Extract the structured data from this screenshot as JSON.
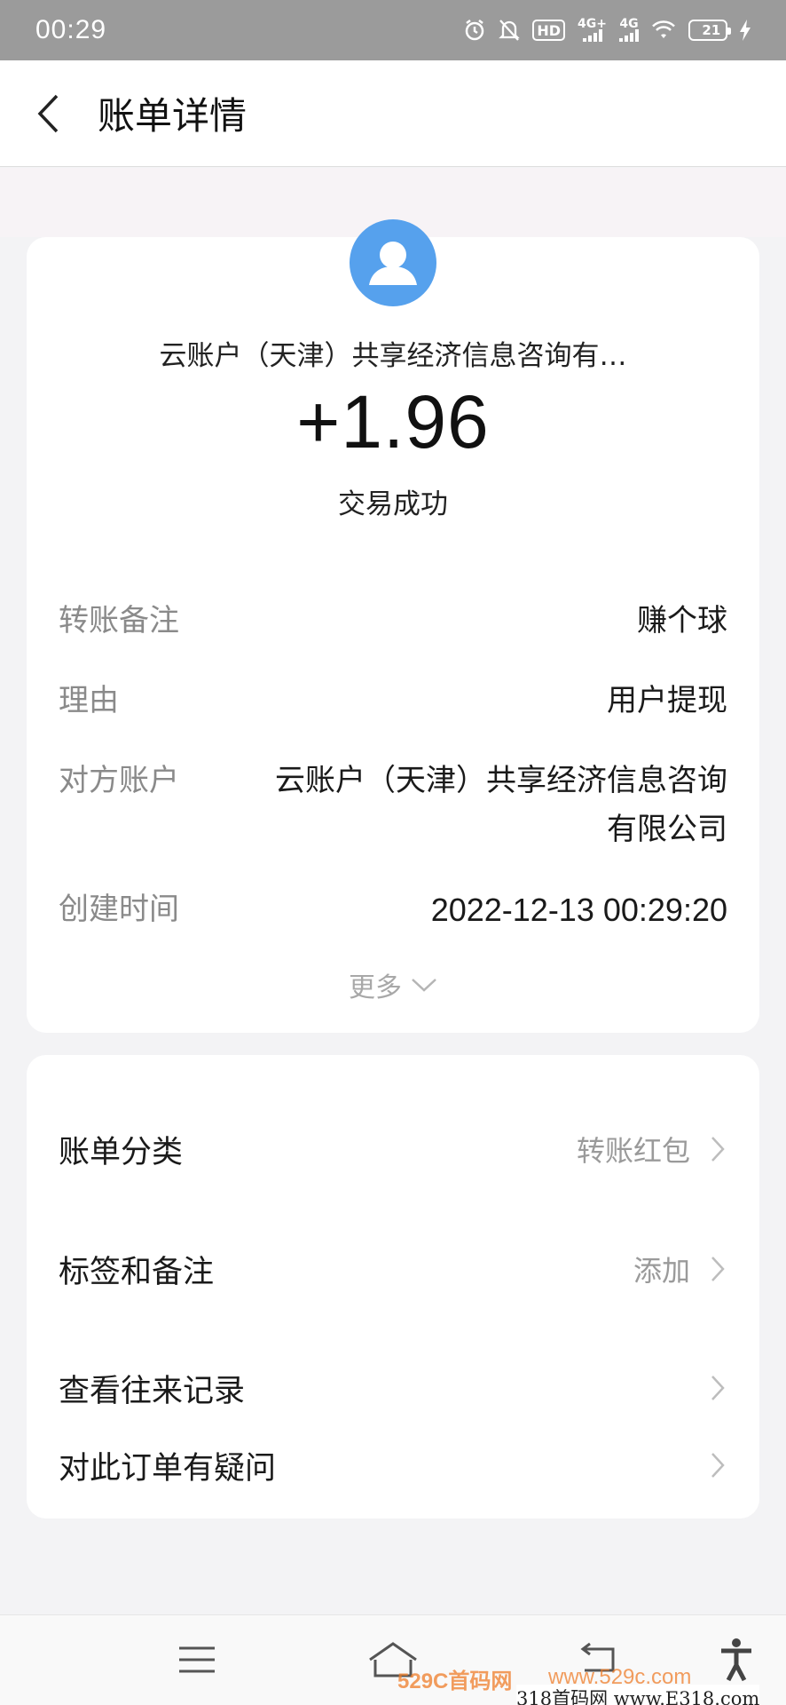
{
  "status_bar": {
    "time": "00:29",
    "hd_label": "HD",
    "net1_label": "4G+",
    "net2_label": "4G",
    "battery_level": "21",
    "battery_fraction": 0.21
  },
  "header": {
    "title": "账单详情"
  },
  "transaction": {
    "payee": "云账户（天津）共享经济信息咨询有…",
    "amount": "+1.96",
    "status": "交易成功"
  },
  "details": [
    {
      "label": "转账备注",
      "value": "赚个球"
    },
    {
      "label": "理由",
      "value": "用户提现"
    },
    {
      "label": "对方账户",
      "value_line1": "云账户（天津）共享经济信息咨询",
      "value_line2": "有限公司"
    },
    {
      "label": "创建时间",
      "value": "2022-12-13 00:29:20"
    }
  ],
  "more_label": "更多",
  "actions": [
    {
      "label": "账单分类",
      "value": "转账红包"
    },
    {
      "label": "标签和备注",
      "value": "添加"
    },
    {
      "label": "查看往来记录"
    },
    {
      "label": "对此订单有疑问"
    }
  ],
  "watermarks": {
    "mark1": "529C首码网",
    "mark2": "www.529c.com",
    "mark3": "318首码网 www.E318.com"
  },
  "colors": {
    "accent_avatar": "#56a1ed",
    "status_bar": "#9b9b9b",
    "battery": "#e9b341",
    "watermark": "#ef7d2a"
  }
}
